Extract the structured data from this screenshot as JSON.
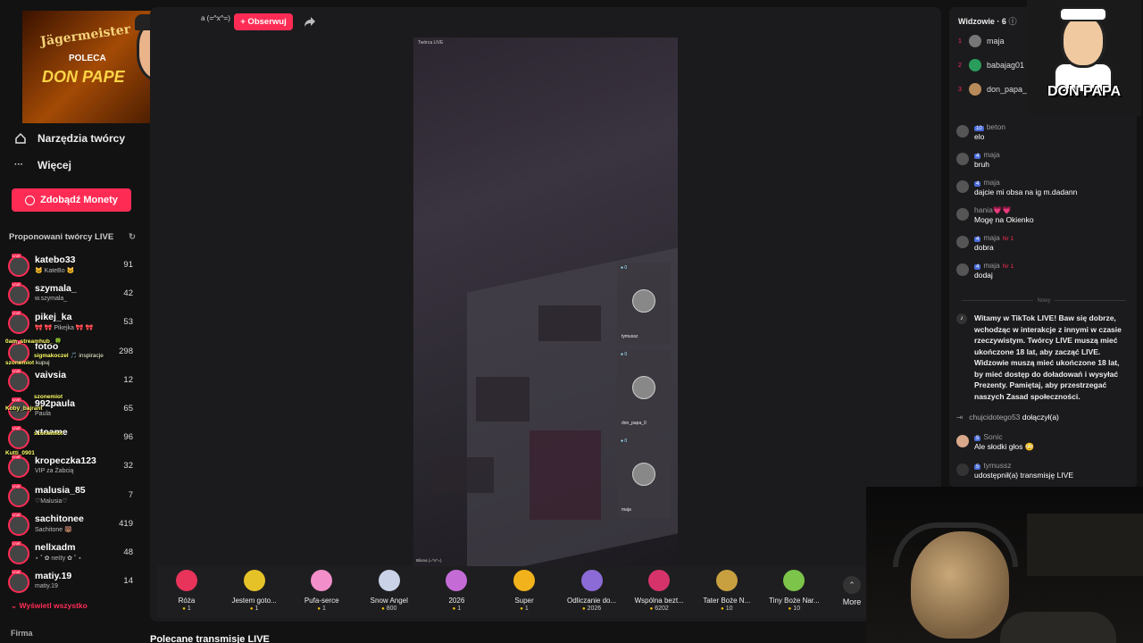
{
  "sidebar": {
    "nav": [
      {
        "label": "Narzędzia twórcy",
        "icon": "home-tool-icon"
      },
      {
        "label": "Więcej",
        "icon": "more-dots-icon"
      }
    ],
    "coins_button": "Zdobądź Monety",
    "suggested_title": "Proponowani twórcy LIVE",
    "creators": [
      {
        "name": "katebo33",
        "sub": "🐱 KateBo 🐱",
        "count": "91"
      },
      {
        "name": "szymala_",
        "sub": "w.szymala_",
        "count": "42"
      },
      {
        "name": "pikej_ka",
        "sub": "🎀 🎀 Pikejka 🎀 🎀",
        "count": "53"
      },
      {
        "name": "fotoo",
        "sub": "",
        "count": "298"
      },
      {
        "name": "vaivsia",
        "sub": "",
        "count": "12"
      },
      {
        "name": "992paula",
        "sub": "Paula",
        "count": "65"
      },
      {
        "name": "xtoame",
        "sub": "",
        "count": "96"
      },
      {
        "name": "kropeczka123",
        "sub": "VIP za Żabcią",
        "count": "32"
      },
      {
        "name": "malusia_85",
        "sub": "♡Malusia♡",
        "count": "7"
      },
      {
        "name": "sachitonee",
        "sub": "Sachitone 🐻",
        "count": "419"
      },
      {
        "name": "nellxadm",
        "sub": "⋆ ˚ ✿ neℓℓy ✿ ˚ ⋆",
        "count": "48"
      },
      {
        "name": "matiy.19",
        "sub": "matiy.19",
        "count": "14"
      }
    ],
    "show_all": "Wyświetl wszystko",
    "firma": "Firma"
  },
  "overlay_chat": [
    {
      "user": "0am_streamhub_",
      "text": "🍀"
    },
    {
      "user": "sigmakoczel",
      "text": "🎵 inspiracje"
    },
    {
      "user": "szonemiot",
      "text": "kupuj"
    },
    {
      "user": "szonemiot",
      "text": ""
    },
    {
      "user": "Koby_bajrant",
      "text": ""
    },
    {
      "user": "szonemiot",
      "text": ""
    },
    {
      "user": "Kutti_0901",
      "text": ""
    }
  ],
  "ad_left": {
    "brand": "Jägermeister",
    "poleca": "POLECA",
    "name": "DON PAPE"
  },
  "ad_right": {
    "name": "DON PAPA"
  },
  "header": {
    "host_name": "a (=^x^=)",
    "follow_label": "+ Obserwuj"
  },
  "stream": {
    "label": "Twórca LIVE",
    "footer": "Bliona (=^x^=)",
    "guests": [
      {
        "name": "tymussz"
      },
      {
        "name": "don_papa_0"
      },
      {
        "name": "maja"
      }
    ]
  },
  "gifts": [
    {
      "name": "Róża",
      "price": "1",
      "icon": "rose-icon",
      "color": "#e8335a"
    },
    {
      "name": "Jestem goto...",
      "price": "1",
      "icon": "sponge-icon",
      "color": "#e6c229"
    },
    {
      "name": "Pufa-serce",
      "price": "1",
      "icon": "heart-pouf-icon",
      "color": "#f28ec9"
    },
    {
      "name": "Snow Angel",
      "price": "800",
      "icon": "snow-angel-icon",
      "color": "#c9d2e6"
    },
    {
      "name": "2026",
      "price": "1",
      "icon": "year-2026-icon",
      "color": "#c46bd6"
    },
    {
      "name": "Super",
      "price": "1",
      "icon": "sunglasses-icon",
      "color": "#f2b21b"
    },
    {
      "name": "Odliczanie do...",
      "price": "2026",
      "icon": "countdown-icon",
      "color": "#8c6bd6"
    },
    {
      "name": "Wspólna bezt...",
      "price": "6202",
      "icon": "together-icon",
      "color": "#d6336b"
    },
    {
      "name": "Tater Boże N...",
      "price": "10",
      "icon": "potato-icon",
      "color": "#c9a040"
    },
    {
      "name": "Tiny Boże Nar...",
      "price": "10",
      "icon": "tiny-gift-icon",
      "color": "#7cc44a"
    }
  ],
  "gift_more": "More",
  "recommended": "Polecane transmisje LIVE",
  "viewers": {
    "title": "Widzowie · 6",
    "list": [
      {
        "rank": "1",
        "name": "maja"
      },
      {
        "rank": "2",
        "name": "babajag01"
      },
      {
        "rank": "3",
        "name": "don_papa_"
      }
    ]
  },
  "chat": [
    {
      "level": "10",
      "user": "beton",
      "badge": "",
      "text": "elo"
    },
    {
      "level": "4",
      "user": "maja",
      "badge": "",
      "text": "bruh"
    },
    {
      "level": "4",
      "user": "maja",
      "badge": "",
      "text": "dajcie mi obsa na ig m.dadann"
    },
    {
      "level": "",
      "user": "hania💗💗",
      "badge": "",
      "text": "Mogę na Okienko"
    },
    {
      "level": "4",
      "user": "maja",
      "badge": "Nr 1",
      "text": "dobra"
    },
    {
      "level": "4",
      "user": "maja",
      "badge": "Nr 1",
      "text": "dodaj"
    }
  ],
  "new_divider": "Nowy",
  "welcome": "Witamy w TikTok LIVE! Baw się dobrze, wchodząc w interakcje z innymi w czasie rzeczywistym. Twórcy LIVE muszą mieć ukończone 18 lat, aby zacząć LIVE. Widzowie muszą mieć ukończone 18 lat, by mieć dostęp do doładowań i wysyłać Prezenty. Pamiętaj, aby przestrzegać naszych Zasad społeczności.",
  "join_line": {
    "user": "chujcidotego53",
    "action": "dołączył(a)"
  },
  "sonic": {
    "level": "5",
    "user": "Sonic",
    "text": "Ale słodki głos 😳"
  },
  "share_line": {
    "level": "5",
    "user": "tymussz",
    "text": "udostępnił(a) transmisję LIVE"
  }
}
